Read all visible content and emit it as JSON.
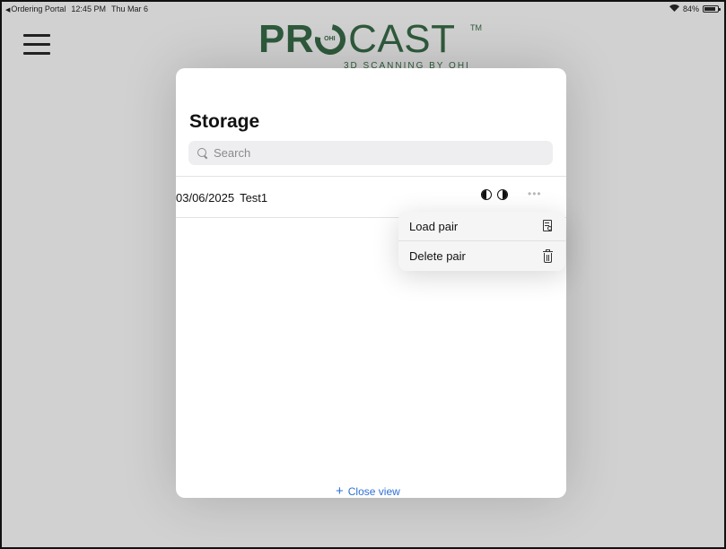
{
  "status_bar": {
    "back_app": "Ordering Portal",
    "time": "12:45 PM",
    "date": "Thu Mar 6",
    "battery": "84%",
    "battery_level": 0.84
  },
  "logo": {
    "word_left": "PR",
    "o_text": "OHI",
    "word_right": "CAST",
    "tm": "TM",
    "subtitle": "3D SCANNING BY OHI"
  },
  "storage": {
    "title": "Storage",
    "search_placeholder": "Search",
    "items": [
      {
        "date": "03/06/2025",
        "name": "Test1"
      }
    ]
  },
  "context_menu": {
    "items": [
      {
        "label": "Load pair",
        "icon": "document-search-icon"
      },
      {
        "label": "Delete pair",
        "icon": "trash-icon"
      }
    ]
  },
  "footer": {
    "close_label": "Close view"
  },
  "colors": {
    "brand_green": "#2f5a3c",
    "link_blue": "#2f6fd6",
    "backdrop": "#d1d1d1"
  }
}
